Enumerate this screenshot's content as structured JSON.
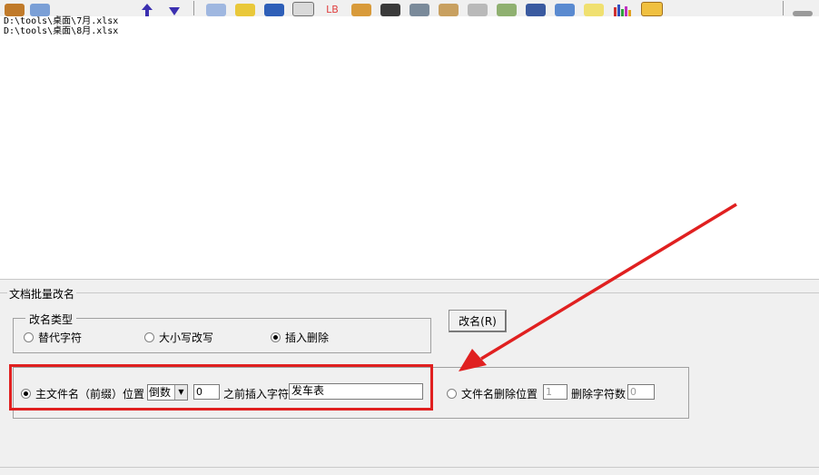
{
  "toolbar": {
    "icons": [
      "open-icon",
      "toolbox-icon",
      "arrow-up-icon",
      "arrow-down-icon",
      "spreadsheet-icon",
      "folder-icon",
      "name-icon",
      "checklist-icon",
      "letter-case-icon",
      "pencil-icon",
      "rename-icon",
      "disk-icon",
      "tag-icon",
      "printer-icon",
      "network-icon",
      "monitor-icon",
      "screen-icon",
      "document-icon",
      "bar-chart-icon",
      "calendar-icon",
      "key-icon"
    ]
  },
  "file_list": [
    "D:\\tools\\桌面\\7月.xlsx",
    "D:\\tools\\桌面\\8月.xlsx"
  ],
  "rename_panel": {
    "group_title": "文档批量改名",
    "type_frame_title": "改名类型",
    "types": {
      "replace": "替代字符",
      "case": "大小写改写",
      "insert_delete": "插入删除"
    },
    "selected_type": "插入删除",
    "rename_button": "改名(R)",
    "insert": {
      "option_label": "主文件名（前缀）位置",
      "direction": "倒数",
      "position": "0",
      "before_label": "之前插入字符",
      "text": "发车表"
    },
    "delete": {
      "option_label": "文件名删除位置",
      "position": "1",
      "count_label": "删除字符数",
      "count": "0"
    },
    "selected_mode": "insert"
  },
  "annotation": {
    "color": "#e02020"
  }
}
